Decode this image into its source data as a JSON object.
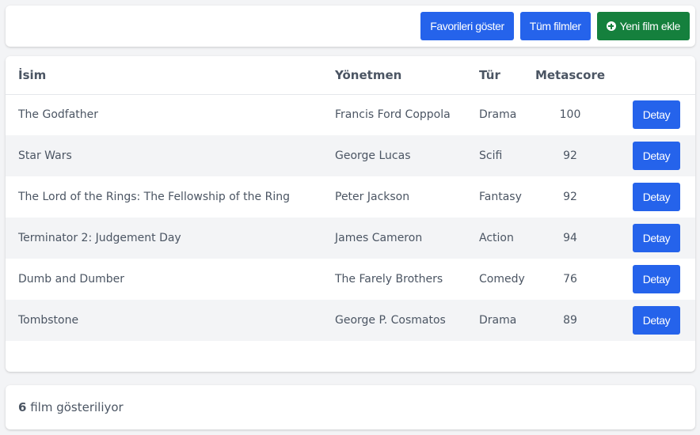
{
  "toolbar": {
    "show_favorites": "Favorileri göster",
    "all_movies": "Tüm filmler",
    "add_movie": "Yeni film ekle"
  },
  "table": {
    "headers": {
      "name": "İsim",
      "director": "Yönetmen",
      "genre": "Tür",
      "metascore": "Metascore"
    },
    "rows": [
      {
        "name": "The Godfather",
        "director": "Francis Ford Coppola",
        "genre": "Drama",
        "metascore": "100",
        "action": "Detay"
      },
      {
        "name": "Star Wars",
        "director": "George Lucas",
        "genre": "Scifi",
        "metascore": "92",
        "action": "Detay"
      },
      {
        "name": "The Lord of the Rings: The Fellowship of the Ring",
        "director": "Peter Jackson",
        "genre": "Fantasy",
        "metascore": "92",
        "action": "Detay"
      },
      {
        "name": "Terminator 2: Judgement Day",
        "director": "James Cameron",
        "genre": "Action",
        "metascore": "94",
        "action": "Detay"
      },
      {
        "name": "Dumb and Dumber",
        "director": "The Farely Brothers",
        "genre": "Comedy",
        "metascore": "76",
        "action": "Detay"
      },
      {
        "name": "Tombstone",
        "director": "George P. Cosmatos",
        "genre": "Drama",
        "metascore": "89",
        "action": "Detay"
      }
    ]
  },
  "footer": {
    "count": "6",
    "count_suffix": " film gösteriliyor"
  },
  "colors": {
    "primary": "#2563eb",
    "success": "#15803d"
  }
}
